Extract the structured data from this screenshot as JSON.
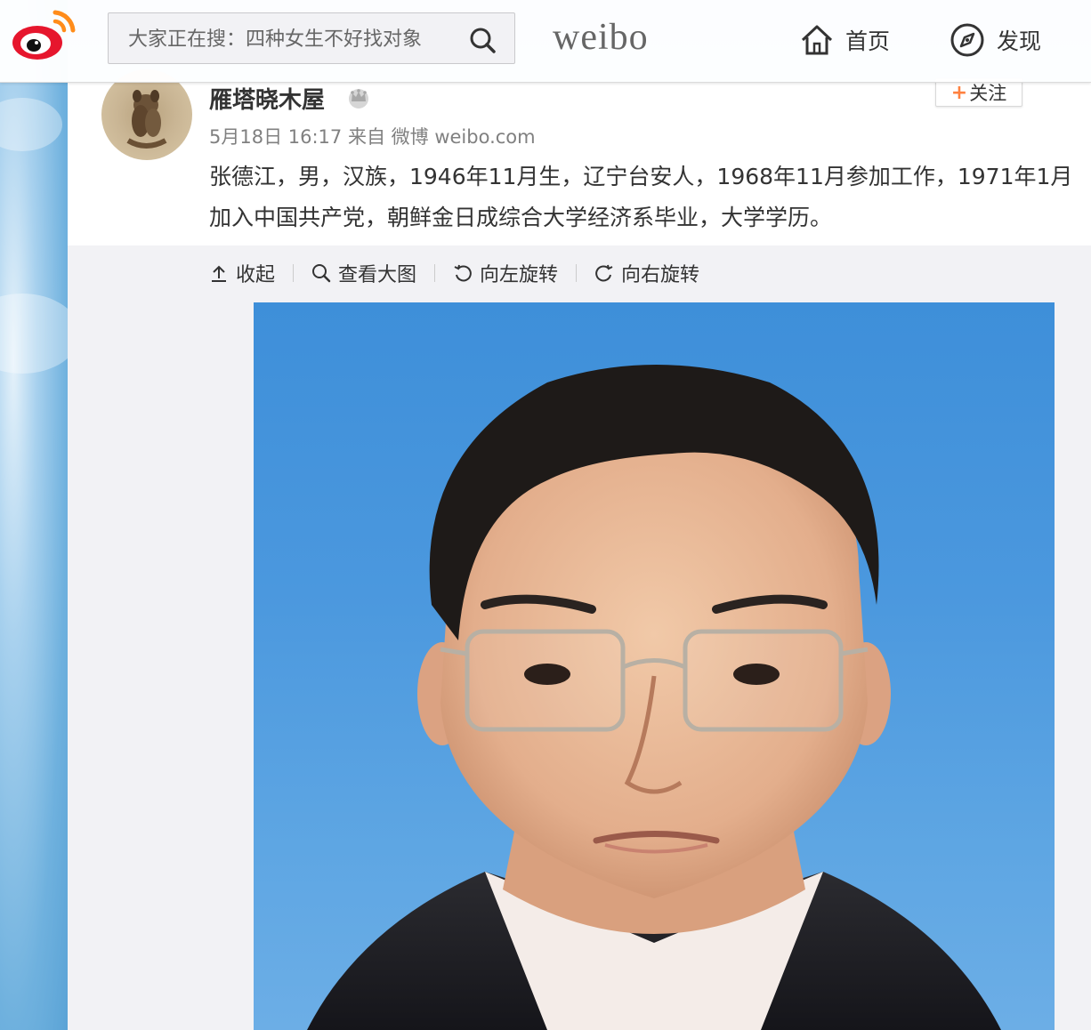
{
  "search": {
    "placeholder": "大家正在搜：四种女生不好找对象"
  },
  "brand": "weibo",
  "nav": {
    "home_label": "首页",
    "discover_label": "发现"
  },
  "post": {
    "username": "雁塔晓木屋",
    "timestamp": "5月18日 16:17",
    "from_label": "来自",
    "source": "微博 weibo.com",
    "follow_label": "关注",
    "text": "张德江，男，汉族，1946年11月生，辽宁台安人，1968年11月参加工作，1971年1月加入中国共产党，朝鲜金日成综合大学经济系毕业，大学学历。"
  },
  "toolbar": {
    "collapse_label": "收起",
    "view_large_label": "查看大图",
    "rotate_left_label": "向左旋转",
    "rotate_right_label": "向右旋转"
  },
  "colors": {
    "accent_orange": "#ff8140",
    "weibo_red": "#e6162d",
    "photo_bg": "#4a96dc"
  }
}
